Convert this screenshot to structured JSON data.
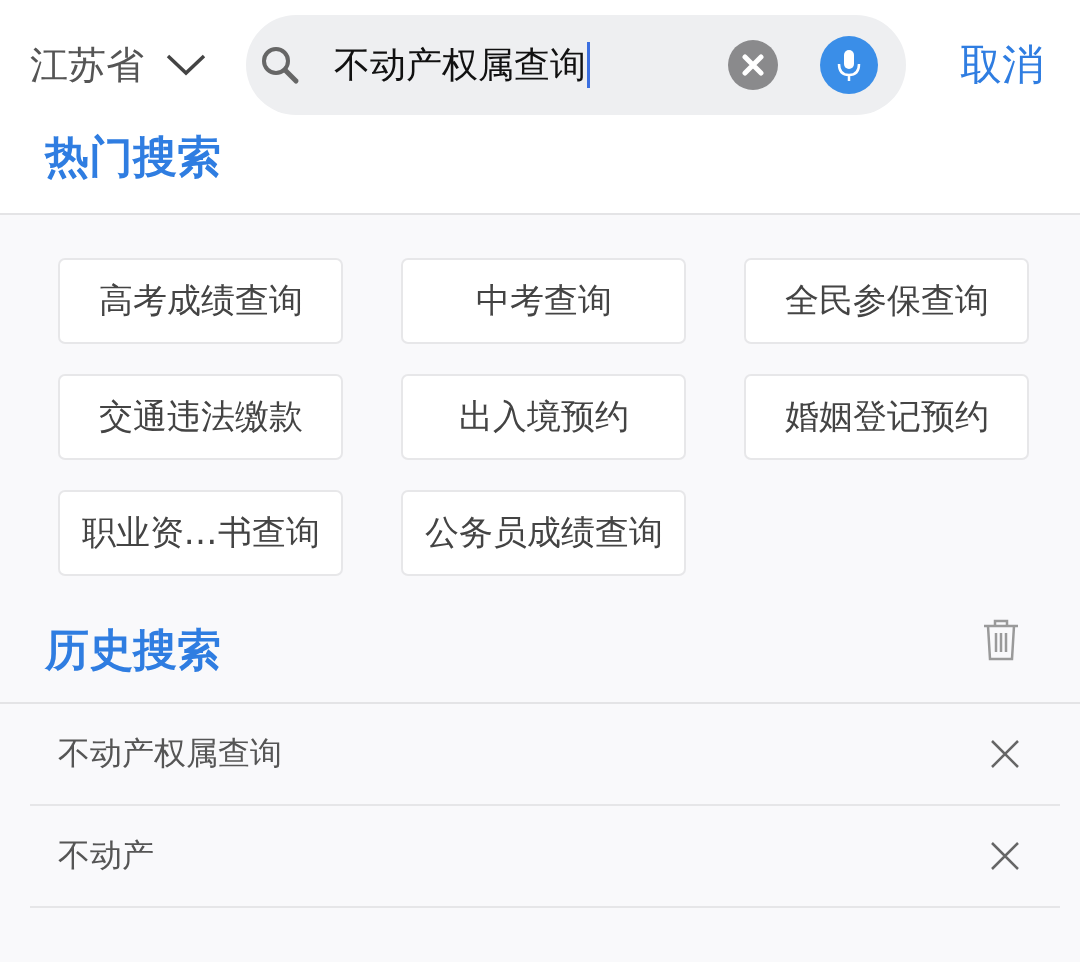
{
  "location": {
    "label": "江苏省"
  },
  "search": {
    "value": "不动产权属查询"
  },
  "cancel": {
    "label": "取消"
  },
  "hot_search": {
    "title": "热门搜索",
    "items": [
      {
        "label": "高考成绩查询"
      },
      {
        "label": "中考查询"
      },
      {
        "label": "全民参保查询"
      },
      {
        "label": "交通违法缴款"
      },
      {
        "label": "出入境预约"
      },
      {
        "label": "婚姻登记预约"
      },
      {
        "label": "职业资…书查询"
      },
      {
        "label": "公务员成绩查询"
      }
    ]
  },
  "history": {
    "title": "历史搜索",
    "items": [
      {
        "label": "不动产权属查询"
      },
      {
        "label": "不动产"
      }
    ]
  }
}
